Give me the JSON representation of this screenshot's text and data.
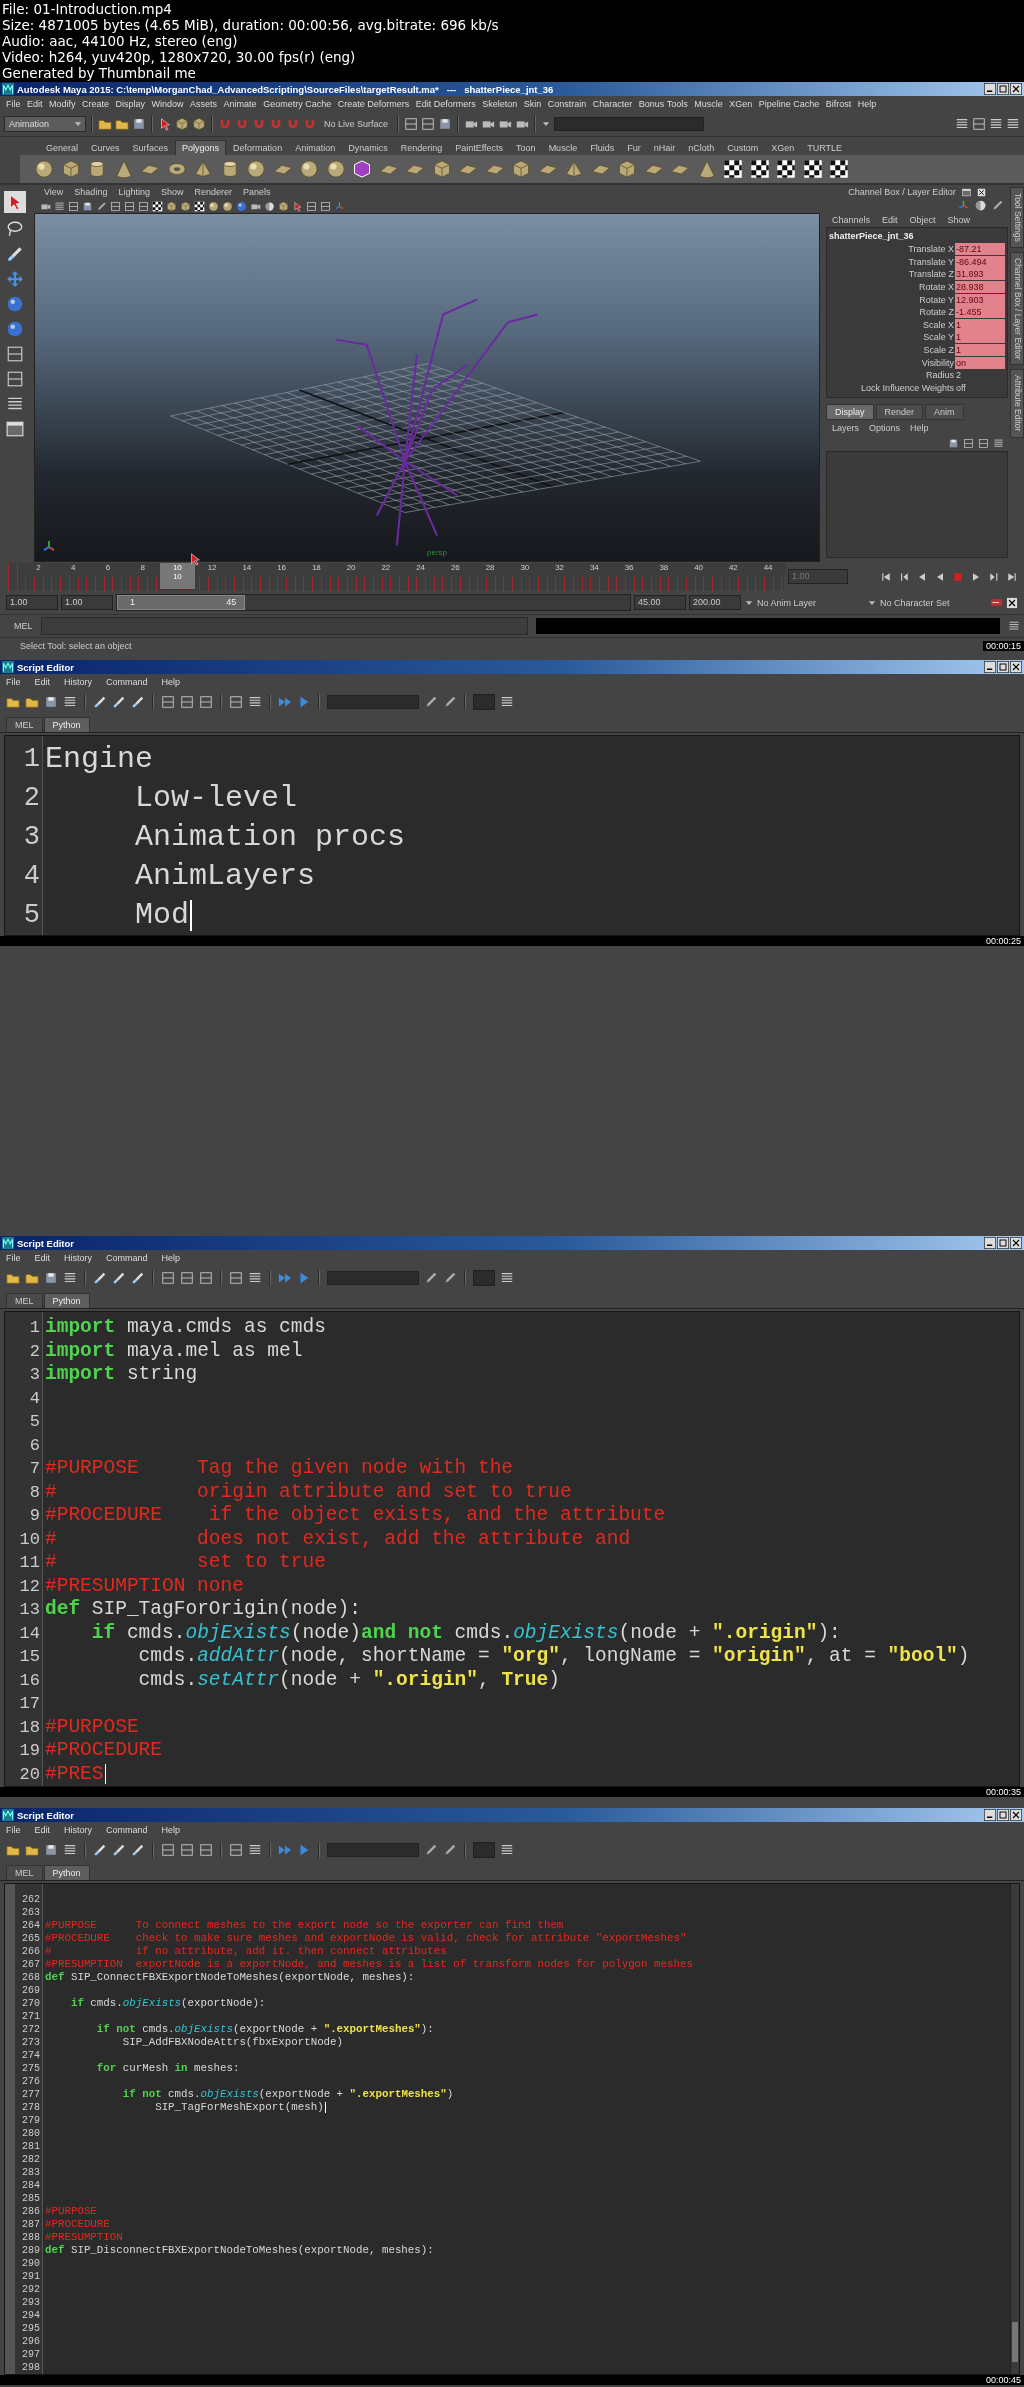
{
  "file_info": [
    "File: 01-Introduction.mp4",
    "Size: 4871005 bytes (4.65 MiB), duration: 00:00:56, avg.bitrate: 696 kb/s",
    "Audio: aac, 44100 Hz, stereo (eng)",
    "Video: h264, yuv420p, 1280x720, 30.00 fps(r) (eng)",
    "Generated by Thumbnail me"
  ],
  "frames": [
    {
      "kind": "maya",
      "title": "Autodesk Maya 2015: C:\\temp\\MorganChad_AdvancedScripting\\SourceFiles\\targetResult.ma*   ---   shatterPiece_jnt_36",
      "menu": [
        "File",
        "Edit",
        "Modify",
        "Create",
        "Display",
        "Window",
        "Assets",
        "Animate",
        "Geometry Cache",
        "Create Deformers",
        "Edit Deformers",
        "Skeleton",
        "Skin",
        "Constrain",
        "Character",
        "Bonus Tools",
        "Muscle",
        "XGen",
        "Pipeline Cache",
        "Bifrost",
        "Help"
      ],
      "mode": "Animation",
      "live_surface": "No Live Surface",
      "shelf_tabs": [
        {
          "label": "General",
          "selected": false
        },
        {
          "label": "Curves",
          "selected": false
        },
        {
          "label": "Surfaces",
          "selected": false
        },
        {
          "label": "Polygons",
          "selected": true
        },
        {
          "label": "Deformation",
          "selected": false
        },
        {
          "label": "Animation",
          "selected": false
        },
        {
          "label": "Dynamics",
          "selected": false
        },
        {
          "label": "Rendering",
          "selected": false
        },
        {
          "label": "PaintEffects",
          "selected": false
        },
        {
          "label": "Toon",
          "selected": false
        },
        {
          "label": "Muscle",
          "selected": false
        },
        {
          "label": "Fluids",
          "selected": false
        },
        {
          "label": "Fur",
          "selected": false
        },
        {
          "label": "nHair",
          "selected": false
        },
        {
          "label": "nCloth",
          "selected": false
        },
        {
          "label": "Custom",
          "selected": false
        },
        {
          "label": "XGen",
          "selected": false
        },
        {
          "label": "TURTLE",
          "selected": false
        }
      ],
      "panel_menu": [
        "View",
        "Shading",
        "Lighting",
        "Show",
        "Renderer",
        "Panels"
      ],
      "camera_label": "persp",
      "channel_box": {
        "title": "Channel Box / Layer Editor",
        "menu": [
          "Channels",
          "Edit",
          "Object",
          "Show"
        ],
        "object": "shatterPiece_jnt_36",
        "attributes": [
          {
            "name": "Translate X",
            "value": "-87.21",
            "keyed": true
          },
          {
            "name": "Translate Y",
            "value": "-86.494",
            "keyed": true
          },
          {
            "name": "Translate Z",
            "value": "31.893",
            "keyed": true
          },
          {
            "name": "Rotate X",
            "value": "28.938",
            "keyed": true
          },
          {
            "name": "Rotate Y",
            "value": "12.903",
            "keyed": true
          },
          {
            "name": "Rotate Z",
            "value": "-1.455",
            "keyed": true
          },
          {
            "name": "Scale X",
            "value": "1",
            "keyed": true
          },
          {
            "name": "Scale Y",
            "value": "1",
            "keyed": true
          },
          {
            "name": "Scale Z",
            "value": "1",
            "keyed": true
          },
          {
            "name": "Visibility",
            "value": "on",
            "keyed": true
          },
          {
            "name": "Radius",
            "value": "2",
            "keyed": false
          },
          {
            "name": "Lock Influence Weights",
            "value": "off",
            "keyed": false
          }
        ],
        "layer_tabs": [
          {
            "label": "Display",
            "selected": true
          },
          {
            "label": "Render",
            "selected": false
          },
          {
            "label": "Anim",
            "selected": false
          }
        ],
        "layer_menu": [
          "Layers",
          "Options",
          "Help"
        ]
      },
      "side_tabs": [
        "Tool Settings",
        "Channel Box / Layer Editor",
        "Attribute Editor"
      ],
      "timeline": {
        "ticks": [
          {
            "label": "2",
            "selected": false
          },
          {
            "label": "4",
            "selected": false
          },
          {
            "label": "6",
            "selected": false
          },
          {
            "label": "8",
            "selected": false
          },
          {
            "label": "10",
            "selected": true
          },
          {
            "label": "12",
            "selected": false
          },
          {
            "label": "14",
            "selected": false
          },
          {
            "label": "16",
            "selected": false
          },
          {
            "label": "18",
            "selected": false
          },
          {
            "label": "20",
            "selected": false
          },
          {
            "label": "22",
            "selected": false
          },
          {
            "label": "24",
            "selected": false
          },
          {
            "label": "26",
            "selected": false
          },
          {
            "label": "28",
            "selected": false
          },
          {
            "label": "30",
            "selected": false
          },
          {
            "label": "32",
            "selected": false
          },
          {
            "label": "34",
            "selected": false
          },
          {
            "label": "36",
            "selected": false
          },
          {
            "label": "38",
            "selected": false
          },
          {
            "label": "40",
            "selected": false
          },
          {
            "label": "42",
            "selected": false
          },
          {
            "label": "44",
            "selected": false
          }
        ],
        "current_frame": "10",
        "current_time": "1.00"
      },
      "range": {
        "start": "1.00",
        "playback_start": "1.00",
        "slider_start": "1",
        "slider_end": "45",
        "level": 0.25,
        "playback_end": "45.00",
        "end": "200.00"
      },
      "anim_layer": "No Anim Layer",
      "character_set": "No Character Set",
      "command_label": "MEL",
      "help_line": "Select Tool: select an object",
      "timestamp": "00:00:15"
    },
    {
      "kind": "script_editor",
      "title": "Script Editor",
      "menu": [
        "File",
        "Edit",
        "History",
        "Command",
        "Help"
      ],
      "tabs": [
        {
          "label": "MEL",
          "selected": false
        },
        {
          "label": "Python",
          "selected": true
        }
      ],
      "timestamp": "00:00:25",
      "lines": [
        {
          "number": "1",
          "caret": false,
          "tokens": [
            {
              "kind": "plain",
              "text": "Engine"
            }
          ]
        },
        {
          "number": "2",
          "caret": false,
          "tokens": [
            {
              "kind": "plain",
              "text": "     Low-level"
            }
          ]
        },
        {
          "number": "3",
          "caret": false,
          "tokens": [
            {
              "kind": "plain",
              "text": "     Animation procs"
            }
          ]
        },
        {
          "number": "4",
          "caret": false,
          "tokens": [
            {
              "kind": "plain",
              "text": "     AnimLayers"
            }
          ]
        },
        {
          "number": "5",
          "caret": true,
          "tokens": [
            {
              "kind": "plain",
              "text": "     Mod"
            }
          ]
        }
      ]
    },
    {
      "kind": "script_editor",
      "title": "Script Editor",
      "menu": [
        "File",
        "Edit",
        "History",
        "Command",
        "Help"
      ],
      "tabs": [
        {
          "label": "MEL",
          "selected": false
        },
        {
          "label": "Python",
          "selected": true
        }
      ],
      "timestamp": "00:00:35",
      "lines": [
        {
          "number": "1",
          "caret": false,
          "tokens": [
            {
              "kind": "keyword",
              "text": "import"
            },
            {
              "kind": "plain",
              "text": " maya.cmds as cmds"
            }
          ]
        },
        {
          "number": "2",
          "caret": false,
          "tokens": [
            {
              "kind": "keyword",
              "text": "import"
            },
            {
              "kind": "plain",
              "text": " maya.mel as mel"
            }
          ]
        },
        {
          "number": "3",
          "caret": false,
          "tokens": [
            {
              "kind": "keyword",
              "text": "import"
            },
            {
              "kind": "plain",
              "text": " string"
            }
          ]
        },
        {
          "number": "4",
          "caret": false
        },
        {
          "number": "5",
          "caret": false
        },
        {
          "number": "6",
          "caret": false
        },
        {
          "number": "7",
          "caret": false,
          "tokens": [
            {
              "kind": "comment",
              "text": "#PURPOSE     Tag the given node with the"
            }
          ]
        },
        {
          "number": "8",
          "caret": false,
          "tokens": [
            {
              "kind": "comment",
              "text": "#            origin attribute and set to true"
            }
          ]
        },
        {
          "number": "9",
          "caret": false,
          "tokens": [
            {
              "kind": "comment",
              "text": "#PROCEDURE    if the object exists, and the attribute"
            }
          ]
        },
        {
          "number": "10",
          "caret": false,
          "tokens": [
            {
              "kind": "comment",
              "text": "#            does not exist, add the attribute and"
            }
          ]
        },
        {
          "number": "11",
          "caret": false,
          "tokens": [
            {
              "kind": "comment",
              "text": "#            set to true"
            }
          ]
        },
        {
          "number": "12",
          "caret": false,
          "tokens": [
            {
              "kind": "comment",
              "text": "#PRESUMPTION none"
            }
          ]
        },
        {
          "number": "13",
          "caret": false,
          "tokens": [
            {
              "kind": "keyword",
              "text": "def"
            },
            {
              "kind": "plain",
              "text": " SIP_TagForOrigin(node):"
            }
          ]
        },
        {
          "number": "14",
          "caret": false,
          "tokens": [
            {
              "kind": "keyword",
              "text": "    if"
            },
            {
              "kind": "plain",
              "text": " cmds."
            },
            {
              "kind": "function",
              "text": "objExists"
            },
            {
              "kind": "plain",
              "text": "(node)"
            },
            {
              "kind": "keyword",
              "text": "and not"
            },
            {
              "kind": "plain",
              "text": " cmds."
            },
            {
              "kind": "function",
              "text": "objExists"
            },
            {
              "kind": "plain",
              "text": "(node + "
            },
            {
              "kind": "string",
              "text": "\".origin\""
            },
            {
              "kind": "plain",
              "text": "):"
            }
          ]
        },
        {
          "number": "15",
          "caret": false,
          "tokens": [
            {
              "kind": "plain",
              "text": "        cmds."
            },
            {
              "kind": "function",
              "text": "addAttr"
            },
            {
              "kind": "plain",
              "text": "(node, shortName = "
            },
            {
              "kind": "string",
              "text": "\"org\""
            },
            {
              "kind": "plain",
              "text": ", longName = "
            },
            {
              "kind": "string",
              "text": "\"origin\""
            },
            {
              "kind": "plain",
              "text": ", at = "
            },
            {
              "kind": "string",
              "text": "\"bool\""
            },
            {
              "kind": "plain",
              "text": ")"
            }
          ]
        },
        {
          "number": "16",
          "caret": false,
          "tokens": [
            {
              "kind": "plain",
              "text": "        cmds."
            },
            {
              "kind": "function",
              "text": "setAttr"
            },
            {
              "kind": "plain",
              "text": "(node + "
            },
            {
              "kind": "string",
              "text": "\".origin\""
            },
            {
              "kind": "plain",
              "text": ", "
            },
            {
              "kind": "constant",
              "text": "True"
            },
            {
              "kind": "plain",
              "text": ")"
            }
          ]
        },
        {
          "number": "17",
          "caret": false
        },
        {
          "number": "18",
          "caret": false,
          "tokens": [
            {
              "kind": "comment",
              "text": "#PURPOSE"
            }
          ]
        },
        {
          "number": "19",
          "caret": false,
          "tokens": [
            {
              "kind": "comment",
              "text": "#PROCEDURE"
            }
          ]
        },
        {
          "number": "20",
          "caret": true,
          "tokens": [
            {
              "kind": "comment",
              "text": "#PRES"
            }
          ]
        }
      ]
    },
    {
      "kind": "script_editor",
      "title": "Script Editor",
      "menu": [
        "File",
        "Edit",
        "History",
        "Command",
        "Help"
      ],
      "tabs": [
        {
          "label": "MEL",
          "selected": false
        },
        {
          "label": "Python",
          "selected": true
        }
      ],
      "timestamp": "00:00:45",
      "lines": [
        {
          "number": "262",
          "caret": false
        },
        {
          "number": "263",
          "caret": false
        },
        {
          "number": "264",
          "caret": false,
          "tokens": [
            {
              "kind": "comment",
              "text": "#PURPOSE      To connect meshes to the export node so the exporter can find them"
            }
          ]
        },
        {
          "number": "265",
          "caret": false,
          "tokens": [
            {
              "kind": "comment",
              "text": "#PROCEDURE    check to make sure meshes and exportNode is valid, check for attribute \"exportMeshes\""
            }
          ]
        },
        {
          "number": "266",
          "caret": false,
          "tokens": [
            {
              "kind": "comment",
              "text": "#             if no attribute, add it. then connect attributes"
            }
          ]
        },
        {
          "number": "267",
          "caret": false,
          "tokens": [
            {
              "kind": "comment",
              "text": "#PRESUMPTION  exportNode is a exportNode, and meshes is a list of transform nodes for polygon meshes"
            }
          ]
        },
        {
          "number": "268",
          "caret": false,
          "tokens": [
            {
              "kind": "keyword",
              "text": "def"
            },
            {
              "kind": "plain",
              "text": " SIP_ConnectFBXExportNodeToMeshes(exportNode, meshes):"
            }
          ]
        },
        {
          "number": "269",
          "caret": false
        },
        {
          "number": "270",
          "caret": false,
          "tokens": [
            {
              "kind": "keyword",
              "text": "    if"
            },
            {
              "kind": "plain",
              "text": " cmds."
            },
            {
              "kind": "function",
              "text": "objExists"
            },
            {
              "kind": "plain",
              "text": "(exportNode):"
            }
          ]
        },
        {
          "number": "271",
          "caret": false
        },
        {
          "number": "272",
          "caret": false,
          "tokens": [
            {
              "kind": "keyword",
              "text": "        if not"
            },
            {
              "kind": "plain",
              "text": " cmds."
            },
            {
              "kind": "function",
              "text": "objExists"
            },
            {
              "kind": "plain",
              "text": "(exportNode + "
            },
            {
              "kind": "string",
              "text": "\".exportMeshes\""
            },
            {
              "kind": "plain",
              "text": "):"
            }
          ]
        },
        {
          "number": "273",
          "caret": false,
          "tokens": [
            {
              "kind": "plain",
              "text": "            SIP_AddFBXNodeAttrs(fbxExportNode)"
            }
          ]
        },
        {
          "number": "274",
          "caret": false
        },
        {
          "number": "275",
          "caret": false,
          "tokens": [
            {
              "kind": "keyword",
              "text": "        for"
            },
            {
              "kind": "plain",
              "text": " curMesh "
            },
            {
              "kind": "keyword",
              "text": "in"
            },
            {
              "kind": "plain",
              "text": " meshes:"
            }
          ]
        },
        {
          "number": "276",
          "caret": false
        },
        {
          "number": "277",
          "caret": false,
          "tokens": [
            {
              "kind": "keyword",
              "text": "            if not"
            },
            {
              "kind": "plain",
              "text": " cmds."
            },
            {
              "kind": "function",
              "text": "objExists"
            },
            {
              "kind": "plain",
              "text": "(exportNode + "
            },
            {
              "kind": "string",
              "text": "\".exportMeshes\""
            },
            {
              "kind": "plain",
              "text": ")"
            }
          ]
        },
        {
          "number": "278",
          "caret": true,
          "tokens": [
            {
              "kind": "plain",
              "text": "                 SIP_TagForMeshExport(mesh)"
            }
          ]
        },
        {
          "number": "279",
          "caret": false
        },
        {
          "number": "280",
          "caret": false
        },
        {
          "number": "281",
          "caret": false
        },
        {
          "number": "282",
          "caret": false
        },
        {
          "number": "283",
          "caret": false
        },
        {
          "number": "284",
          "caret": false
        },
        {
          "number": "285",
          "caret": false
        },
        {
          "number": "286",
          "caret": false,
          "tokens": [
            {
              "kind": "comment",
              "text": "#PURPOSE"
            }
          ]
        },
        {
          "number": "287",
          "caret": false,
          "tokens": [
            {
              "kind": "comment",
              "text": "#PROCEDURE"
            }
          ]
        },
        {
          "number": "288",
          "caret": false,
          "tokens": [
            {
              "kind": "comment",
              "text": "#PRESUMPTION"
            }
          ]
        },
        {
          "number": "289",
          "caret": false,
          "tokens": [
            {
              "kind": "keyword",
              "text": "def"
            },
            {
              "kind": "plain",
              "text": " SIP_DisconnectFBXExportNodeToMeshes(exportNode, meshes):"
            }
          ]
        },
        {
          "number": "290",
          "caret": false
        },
        {
          "number": "291",
          "caret": false
        },
        {
          "number": "292",
          "caret": false
        },
        {
          "number": "293",
          "caret": false
        },
        {
          "number": "294",
          "caret": false
        },
        {
          "number": "295",
          "caret": false
        },
        {
          "number": "296",
          "caret": false
        },
        {
          "number": "297",
          "caret": false
        },
        {
          "number": "298",
          "caret": false
        }
      ]
    }
  ]
}
